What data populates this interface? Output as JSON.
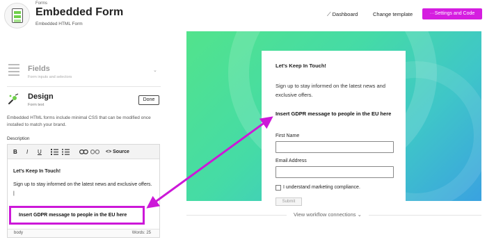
{
  "header": {
    "breadcrumb": "Forms",
    "title": "Embedded Form",
    "subtitle": "Embedded HTML Form",
    "dashboard_label": "Dashboard",
    "change_template_label": "Change template",
    "settings_label": "···Settings and Code",
    "accent_color": "#d51de0"
  },
  "sidebar": {
    "fields": {
      "title": "Fields",
      "subtitle": "Form inputs and selectors",
      "icon": "list-icon"
    },
    "design": {
      "title": "Design",
      "subtitle": "Form text",
      "icon": "paintbrush-icon",
      "done_label": "Done",
      "description": "Embedded HTML forms include minimal CSS that can be modified once installed to match your brand."
    },
    "description_label": "Description",
    "editor": {
      "toolbar": {
        "bold": "B",
        "italic": "I",
        "underline": "U",
        "source": "Source"
      },
      "heading": "Let's Keep In Touch!",
      "body": "Sign up to stay informed on the latest news and exclusive offers. |",
      "highlighted": "Insert GDPR message to people in the EU here",
      "footer_tag": "body",
      "word_count": "Words: 25"
    }
  },
  "preview": {
    "title": "Let's Keep In Touch!",
    "text": "Sign up to stay informed on the latest news and exclusive offers.",
    "gdpr": "Insert GDPR message to people in the EU here",
    "first_name_label": "First Name",
    "email_label": "Email Address",
    "consent_label": "I understand marketing compliance.",
    "submit_label": "Submit",
    "highlight_color": "#cc18d8"
  },
  "workflow": {
    "label": "View workflow connections ⌄"
  }
}
